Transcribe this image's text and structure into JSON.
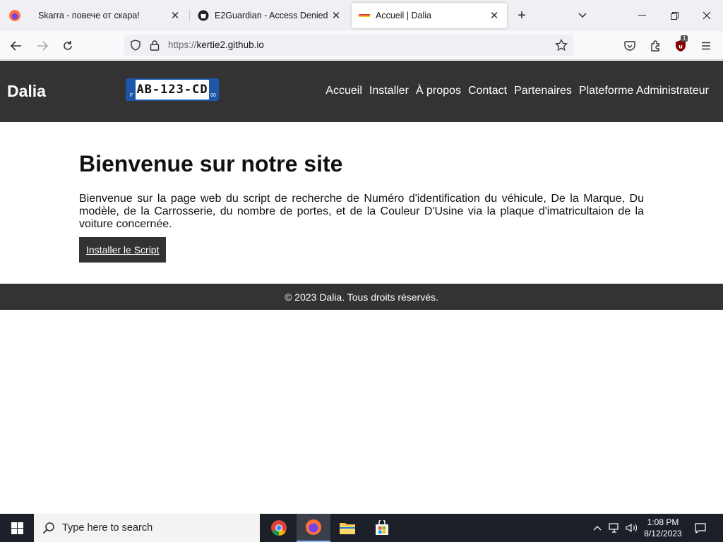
{
  "browser": {
    "tabs": [
      {
        "title": "Skarra - повече от скара!",
        "icon": "generic-favicon"
      },
      {
        "title": "E2Guardian - Access Denied",
        "icon": "github-icon"
      },
      {
        "title": "Accueil | Dalia",
        "icon": "dalia-favicon"
      }
    ],
    "url_scheme": "https://",
    "url_host": "kertie2.github.io",
    "extension_badge": "1"
  },
  "site": {
    "brand": "Dalia",
    "plate": {
      "left": "F",
      "number": "AB-123-CD",
      "right": "00"
    },
    "nav": [
      "Accueil",
      "Installer",
      "À propos",
      "Contact",
      "Partenaires",
      "Plateforme Administrateur"
    ],
    "heading": "Bienvenue sur notre site",
    "intro": "Bienvenue sur la page web du script de recherche de Numéro d'identification du véhicule, De la Marque, Du modèle, de la Carrosserie, du nombre de portes, et de la Couleur D'Usine via la plaque d'imatricultaion de la voiture concernée.",
    "install_button": "Installer le Script",
    "footer": "© 2023 Dalia. Tous droits réservés."
  },
  "taskbar": {
    "search_placeholder": "Type here to search",
    "time": "1:08 PM",
    "date": "8/12/2023"
  },
  "colors": {
    "header_bg": "#333333",
    "plate_blue": "#1b56a8",
    "taskbar_bg": "#1c2029"
  }
}
